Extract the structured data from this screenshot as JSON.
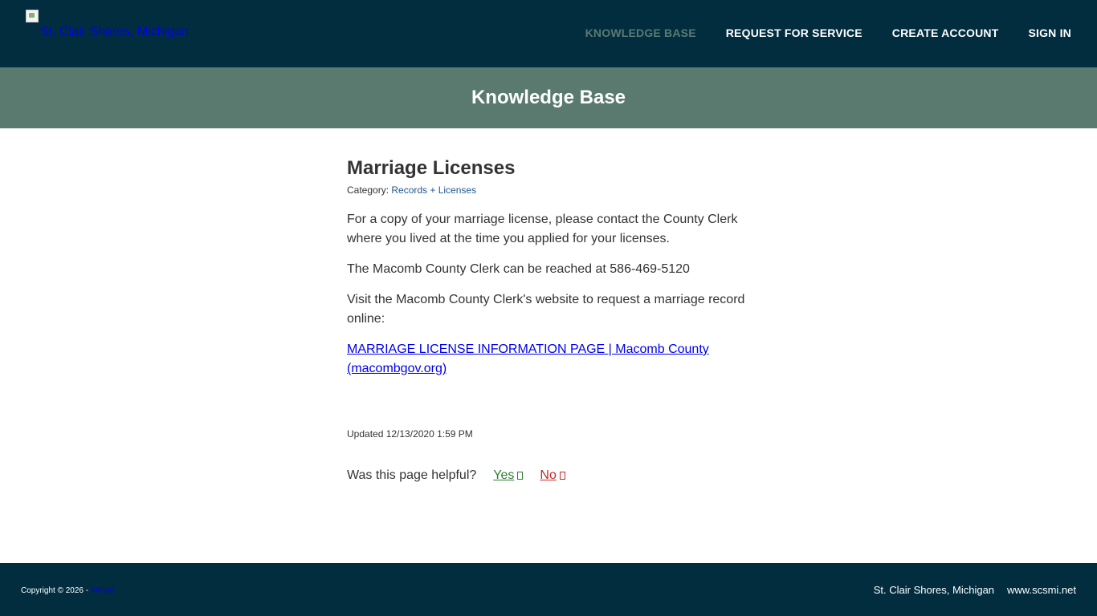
{
  "header": {
    "logo_alt": "St. Clair Shores, Michigan",
    "nav": [
      {
        "label": "KNOWLEDGE BASE"
      },
      {
        "label": "REQUEST FOR SERVICE"
      },
      {
        "label": "CREATE ACCOUNT"
      },
      {
        "label": "SIGN IN"
      }
    ]
  },
  "banner": {
    "title": "Knowledge Base"
  },
  "article": {
    "title": "Marriage Licenses",
    "category_label": "Category: ",
    "category_value": "Records + Licenses",
    "paragraphs": [
      "For a copy of your marriage license, please contact the County Clerk where you lived at the time you applied for your licenses.",
      "The Macomb County Clerk can be reached at 586-469-5120",
      "Visit the Macomb County Clerk's website to request a marriage record online:"
    ],
    "link_text": "MARRIAGE LICENSE INFORMATION PAGE | Macomb County (macombgov.org)",
    "updated": "Updated 12/13/2020 1:59 PM"
  },
  "feedback": {
    "question": "Was this page helpful?",
    "yes": "Yes",
    "no": "No"
  },
  "footer": {
    "copyright": "Copyright © 2026 - ",
    "copyright_link": "YARM",
    "site_name": "St. Clair Shores, Michigan",
    "site_url": "www.scsmi.net"
  },
  "colors": {
    "header_bg": "#022d3f",
    "banner_bg": "#5a7a70",
    "link": "#1f5a8c",
    "yes": "#2e7d32",
    "no": "#c62828"
  }
}
